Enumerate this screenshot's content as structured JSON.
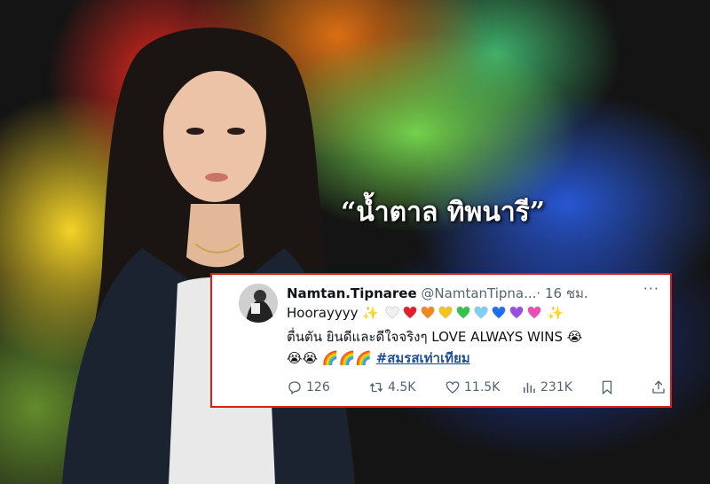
{
  "overlay_title": "“น้ำตาล ทิพนารี”",
  "tweet": {
    "display_name": "Namtan.Tipnaree",
    "handle": "@NamtanTipna...",
    "separator": "·",
    "time": "16 ชม.",
    "more_label": "···",
    "text_line1": "Hoorayyyy",
    "heart_colors": [
      "#f0f0f0",
      "#e0202c",
      "#f08a1c",
      "#f5c518",
      "#33c24a",
      "#7fd0f5",
      "#1d6ff0",
      "#9b4de0",
      "#e94fb7"
    ],
    "text_line2": "ตื่นตัน ยินดีและดีใจจริงๆ LOVE ALWAYS WINS",
    "hashtag": "#สมรสเท่าเทียม",
    "replies": "126",
    "retweets": "4.5K",
    "likes": "11.5K",
    "views": "231K"
  },
  "colors": {
    "border": "#e01c1c",
    "hashtag": "#1d4f9a",
    "muted": "#536471"
  }
}
